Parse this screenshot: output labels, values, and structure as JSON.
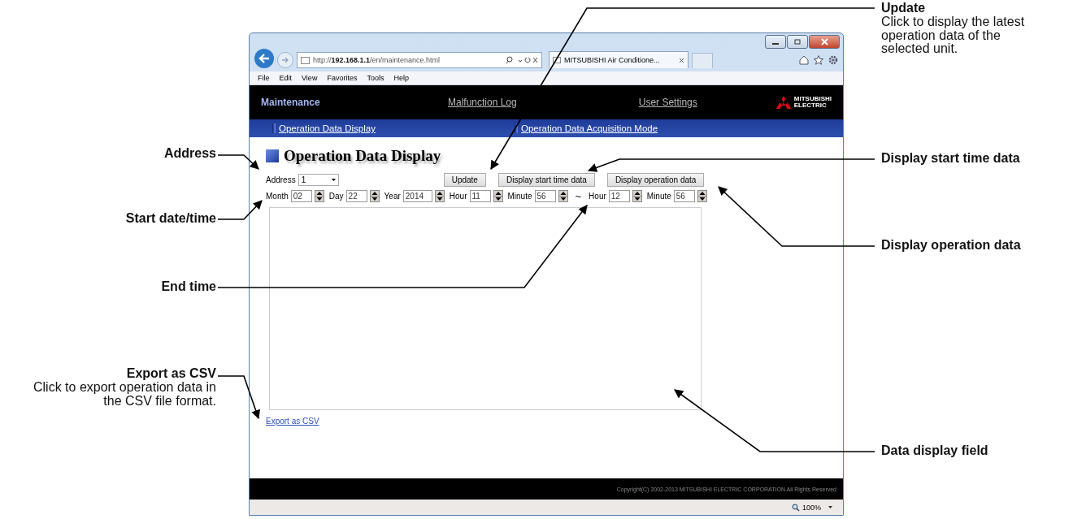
{
  "browser": {
    "address": "http://**192.168.1.1**/en/maintenance.html",
    "tab_title": "MITSUBISHI Air Conditione...",
    "menu": [
      "File",
      "Edit",
      "View",
      "Favorites",
      "Tools",
      "Help"
    ],
    "zoom": "100%"
  },
  "header": {
    "title": "Maintenance",
    "links": [
      "Malfunction Log",
      "User Settings"
    ],
    "logo": [
      "MITSUBISHI",
      "ELECTRIC"
    ]
  },
  "subnav": [
    {
      "label": "Operation Data Display"
    },
    {
      "label": "Operation Data Acquisition Mode"
    }
  ],
  "heading": "Operation Data Display",
  "address": {
    "label": "Address",
    "value": "1"
  },
  "buttons": [
    "Update",
    "Display start time data",
    "Display operation data"
  ],
  "start": [
    {
      "label": "Month",
      "value": "02"
    },
    {
      "label": "Day",
      "value": "22"
    },
    {
      "label": "Year",
      "value": "2014"
    },
    {
      "label": "Hour",
      "value": "11"
    },
    {
      "label": "Minute",
      "value": "56"
    }
  ],
  "separator": "~",
  "end": [
    {
      "label": "Hour",
      "value": "12"
    },
    {
      "label": "Minute",
      "value": "56"
    }
  ],
  "export_link": "Export as CSV",
  "footer": "Copyright(C) 2002-2013 MITSUBISHI ELECTRIC CORPORATION All Rights Reserved",
  "callouts": [
    {
      "title": "Update",
      "description": "Click to display the latest operation data of the selected unit."
    },
    {
      "title": "Display start time data"
    },
    {
      "title": "Display operation data"
    },
    {
      "title": "Data display field"
    },
    {
      "title": "Address"
    },
    {
      "title": "Start date/time"
    },
    {
      "title": "End time"
    },
    {
      "title": "Export as CSV",
      "description": "Click to export operation data in the CSV file format."
    }
  ]
}
